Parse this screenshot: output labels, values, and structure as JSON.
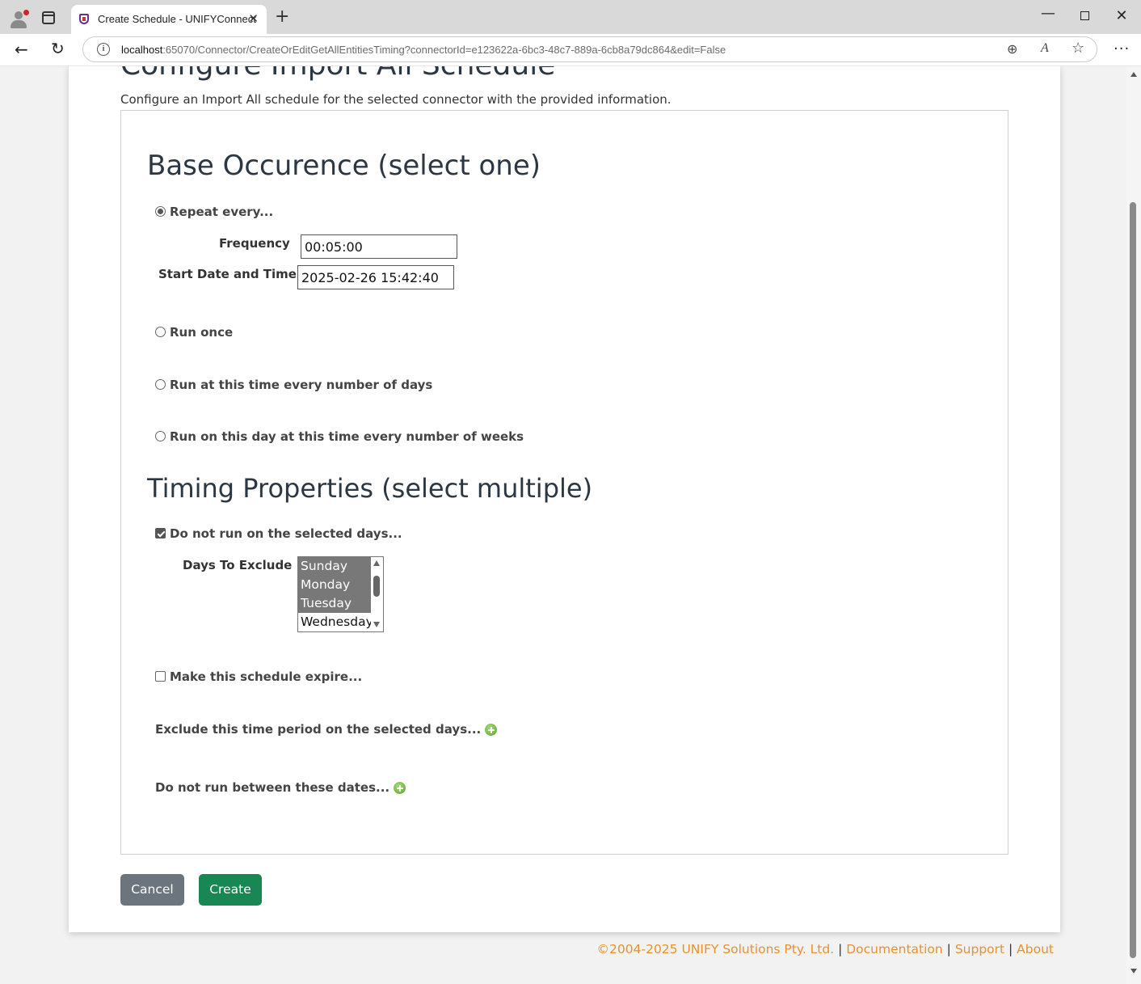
{
  "browser": {
    "tab_title": "Create Schedule - UNIFYConnect",
    "tab_close": "✕",
    "new_tab": "+",
    "url_host": "localhost",
    "url_rest": ":65070/Connector/CreateOrEditGetAllEntitiesTiming?connectorId=e123622a-6bc3-48c7-889a-6cb8a79dc864&edit=False",
    "window_min": "—",
    "window_close": "✕",
    "back": "←",
    "reload": "↻",
    "zoom_icon": "⊕",
    "read_aloud_icon": "A",
    "favorite_icon": "☆",
    "menu": "···"
  },
  "page": {
    "title": "Configure Import All Schedule",
    "description": "Configure an Import All schedule for the selected connector with the provided information."
  },
  "base_occurrence": {
    "heading": "Base Occurence (select one)",
    "options": [
      {
        "label": "Repeat every...",
        "selected": true
      },
      {
        "label": "Run once",
        "selected": false
      },
      {
        "label": "Run at this time every number of days",
        "selected": false
      },
      {
        "label": "Run on this day at this time every number of weeks",
        "selected": false
      }
    ],
    "frequency_label": "Frequency",
    "frequency_value": "00:05:00",
    "start_label": "Start Date and Time",
    "start_value": "2025-02-26 15:42:40"
  },
  "timing": {
    "heading": "Timing Properties (select multiple)",
    "exclude_days_label": "Do not run on the selected days...",
    "exclude_days_checked": true,
    "days_label": "Days To Exclude",
    "days": [
      {
        "label": "Sunday",
        "selected": true
      },
      {
        "label": "Monday",
        "selected": true
      },
      {
        "label": "Tuesday",
        "selected": true
      },
      {
        "label": "Wednesday",
        "selected": false
      }
    ],
    "expire_label": "Make this schedule expire...",
    "expire_checked": false,
    "exclude_period_label": "Exclude this time period on the selected days...",
    "exclude_dates_label": "Do not run between these dates..."
  },
  "buttons": {
    "cancel": "Cancel",
    "create": "Create"
  },
  "footer": {
    "copyright": "©2004-2025 UNIFY Solutions Pty. Ltd.",
    "sep": " | ",
    "documentation": "Documentation",
    "support": "Support",
    "about": "About"
  },
  "colors": {
    "create_button": "#198754",
    "cancel_button": "#6c757d",
    "footer_link": "#e8912d",
    "heading": "#2b3742"
  }
}
